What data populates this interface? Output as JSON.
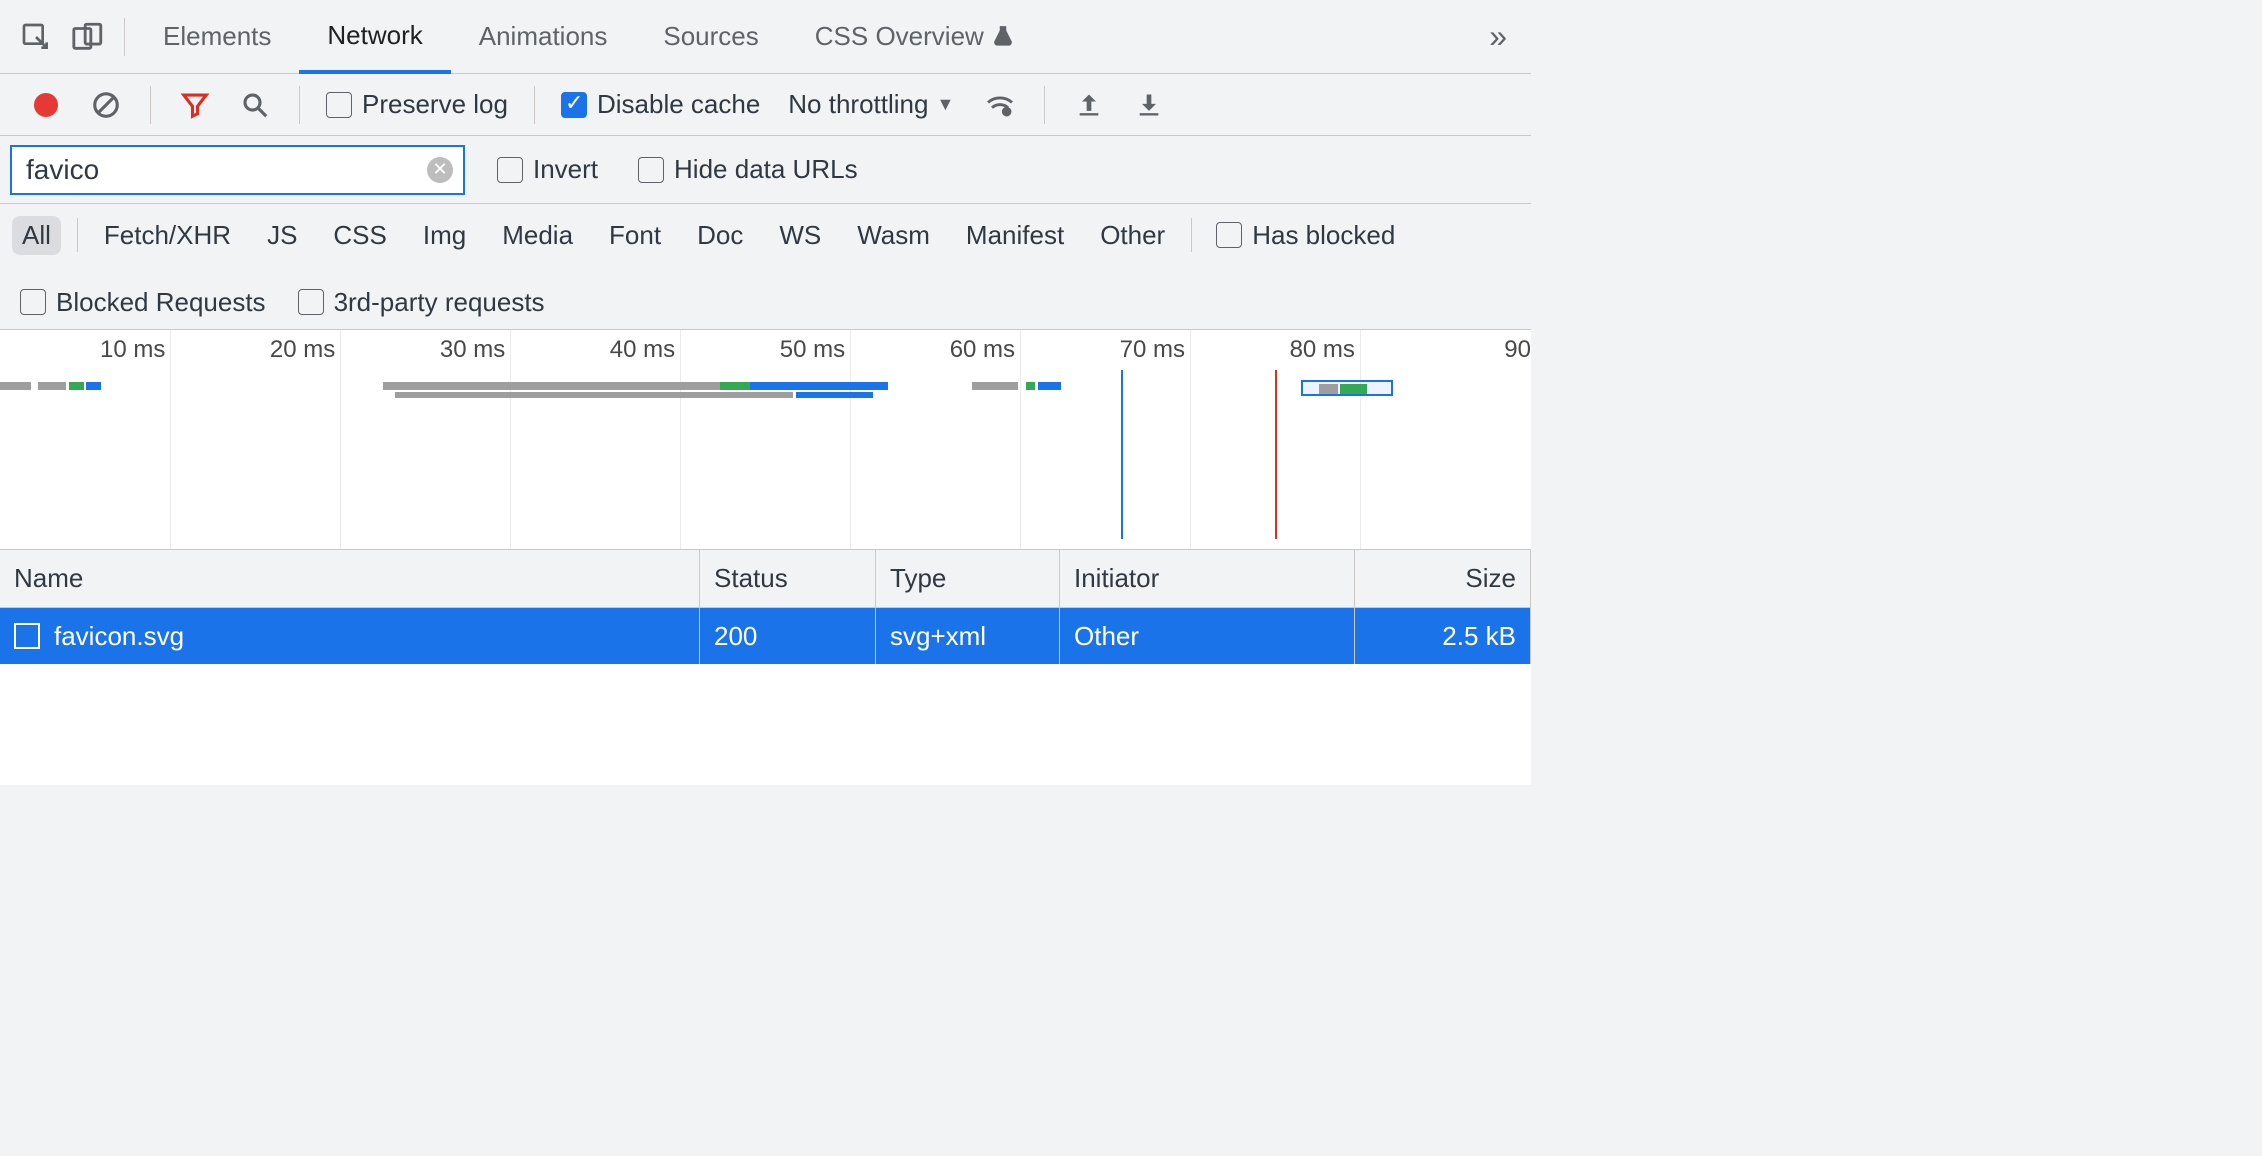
{
  "tabs": {
    "elements": "Elements",
    "network": "Network",
    "animations": "Animations",
    "sources": "Sources",
    "css_overview": "CSS Overview"
  },
  "toolbar": {
    "preserve_log": "Preserve log",
    "disable_cache": "Disable cache",
    "throttle": "No throttling"
  },
  "filter": {
    "value": "favico",
    "invert": "Invert",
    "hide_data_urls": "Hide data URLs"
  },
  "types": {
    "all": "All",
    "fetch_xhr": "Fetch/XHR",
    "js": "JS",
    "css": "CSS",
    "img": "Img",
    "media": "Media",
    "font": "Font",
    "doc": "Doc",
    "ws": "WS",
    "wasm": "Wasm",
    "manifest": "Manifest",
    "other": "Other",
    "has_blocked": "Has blocked",
    "blocked_requests": "Blocked Requests",
    "third_party": "3rd-party requests"
  },
  "timeline": {
    "ticks": [
      "10 ms",
      "20 ms",
      "30 ms",
      "40 ms",
      "50 ms",
      "60 ms",
      "70 ms",
      "80 ms",
      "90"
    ]
  },
  "table": {
    "headers": {
      "name": "Name",
      "status": "Status",
      "type": "Type",
      "initiator": "Initiator",
      "size": "Size"
    },
    "row0": {
      "name": "favicon.svg",
      "status": "200",
      "type": "svg+xml",
      "initiator": "Other",
      "size": "2.5 kB"
    }
  }
}
